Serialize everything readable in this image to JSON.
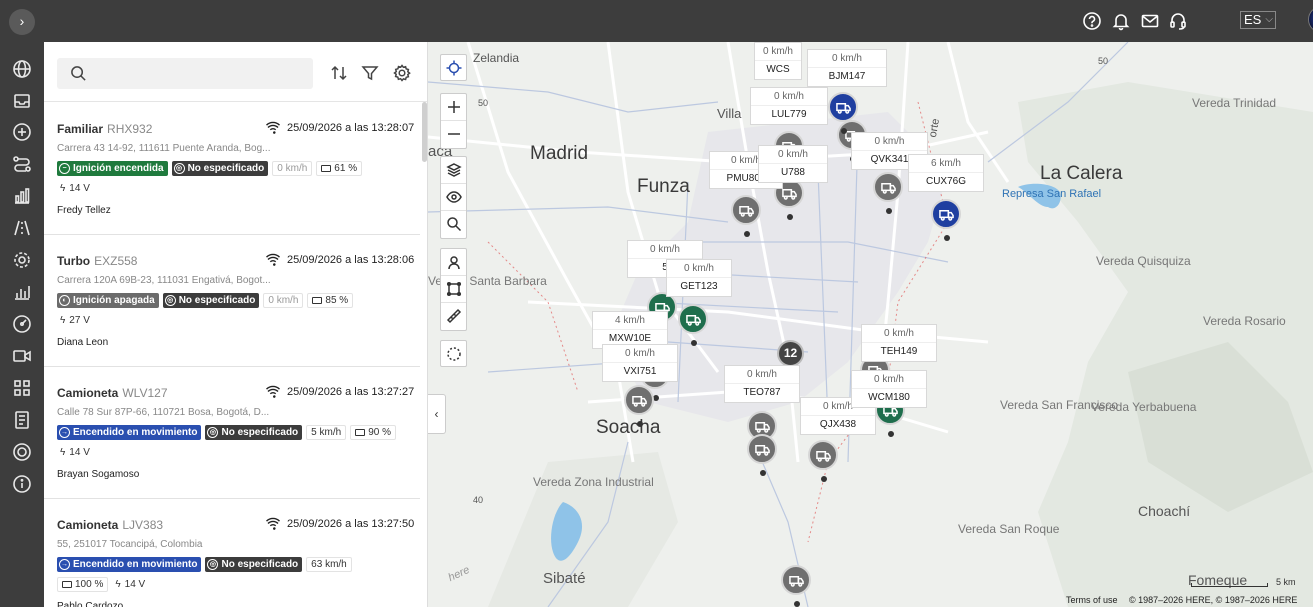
{
  "header": {
    "icons": [
      "help-icon",
      "bell-icon",
      "mail-icon",
      "headset-icon"
    ],
    "language": "ES"
  },
  "rail": {
    "icons": [
      "globe-icon",
      "inbox-icon",
      "plus-circle-icon",
      "route-icon",
      "bar-chart-icon",
      "road-icon",
      "gear-icon",
      "stats-icon",
      "gauge-icon",
      "video-icon",
      "grid-icon",
      "document-icon",
      "support-icon",
      "info-icon"
    ]
  },
  "search": {
    "placeholder": "",
    "value": ""
  },
  "vehicles": [
    {
      "type": "Familiar",
      "plate": "RHX932",
      "date": "25/09/2026 a las 13:28:07",
      "address": "Carrera 43 14-92, 111611 Puente Aranda, Bog...",
      "ignition": "Ignición encendida",
      "ignition_color": "green",
      "driver_status": "No especificado",
      "speed": "0 km/h",
      "battery": "61 %",
      "voltage": "14 V",
      "driver": "Fredy Tellez"
    },
    {
      "type": "Turbo",
      "plate": "EXZ558",
      "date": "25/09/2026 a las 13:28:06",
      "address": "Carrera 120A 69B-23, 111031 Engativá, Bogot...",
      "ignition": "Ignición apagada",
      "ignition_color": "grey",
      "driver_status": "No especificado",
      "speed": "0 km/h",
      "battery": "85 %",
      "voltage": "27 V",
      "driver": "Diana Leon"
    },
    {
      "type": "Camioneta",
      "plate": "WLV127",
      "date": "25/09/2026 a las 13:27:27",
      "address": "Calle 78 Sur 87P-66, 110721 Bosa, Bogotá, D...",
      "ignition": "Encendido en movimiento",
      "ignition_color": "blue",
      "driver_status": "No especificado",
      "speed": "5 km/h",
      "battery": "90 %",
      "voltage": "14 V",
      "driver": "Brayan Sogamoso"
    },
    {
      "type": "Camioneta",
      "plate": "LJV383",
      "date": "25/09/2026 a las 13:27:50",
      "address": "55, 251017 Tocancipá, Colombia",
      "ignition": "Encendido en movimiento",
      "ignition_color": "blue",
      "driver_status": "No especificado",
      "speed": "63 km/h",
      "battery": "100 %",
      "voltage": "14 V",
      "driver": "Pablo Cardozo"
    }
  ],
  "map": {
    "places": [
      "Zelandia",
      "Madrid",
      "Funza",
      "Villa",
      "La Calera",
      "Represa San Rafael",
      "Vereda Trinidad",
      "Vereda Quisquiza",
      "Vereda Rosario",
      "Vereda Santa Barbara",
      "Soacha",
      "Vereda Zona Industrial",
      "Vereda San Francisco",
      "Vereda Yerbabuena",
      "Choachí",
      "Vereda San Roque",
      "Sibaté",
      "Fomeque",
      "aca",
      "orte"
    ],
    "roads": [
      "50",
      "50",
      "40",
      "50"
    ],
    "labels": [
      {
        "speed": "0 km/h",
        "plate": "WCS"
      },
      {
        "speed": "0 km/h",
        "plate": "BJM147"
      },
      {
        "speed": "0 km/h",
        "plate": "LUL779"
      },
      {
        "speed": "0 km/h",
        "plate": "QVK341"
      },
      {
        "speed": "6 km/h",
        "plate": "CUX76G"
      },
      {
        "speed": "0 km/h",
        "plate": "PMU806"
      },
      {
        "speed": "0 km/h",
        "plate": "U788"
      },
      {
        "speed": "0 km/h",
        "plate": "5"
      },
      {
        "speed": "0 km/h",
        "plate": "GET123"
      },
      {
        "speed": "4 km/h",
        "plate": "MXW10E"
      },
      {
        "speed": "0 km/h",
        "plate": "VXI751"
      },
      {
        "speed": "0 km/h",
        "plate": "TEO787"
      },
      {
        "speed": "0 km/h",
        "plate": "QJX438"
      },
      {
        "speed": "0 km/h",
        "plate": "WCM180"
      },
      {
        "speed": "0 km/h",
        "plate": "TEH149"
      }
    ],
    "cluster_count": "12",
    "scale": "5 km",
    "terms": "Terms of use",
    "copyright": "© 1987–2026 HERE, © 1987–2026 HERE",
    "here_logo": "here"
  }
}
